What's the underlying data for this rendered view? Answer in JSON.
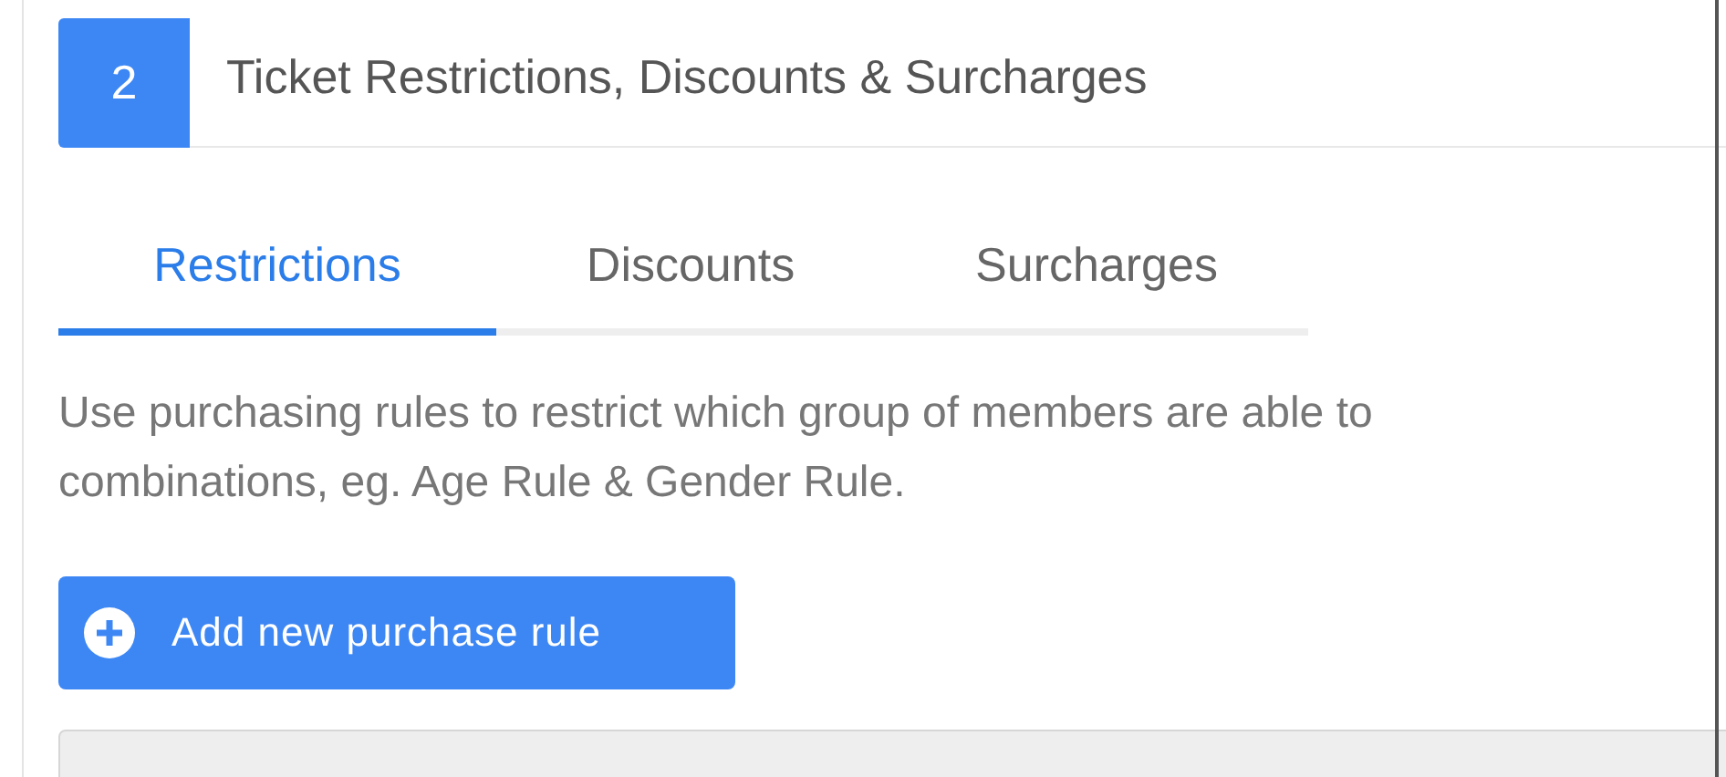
{
  "section": {
    "number": "2",
    "title": "Ticket Restrictions, Discounts & Surcharges"
  },
  "tabs": [
    {
      "label": "Restrictions",
      "selected": true
    },
    {
      "label": "Discounts",
      "selected": false
    },
    {
      "label": "Surcharges",
      "selected": false
    }
  ],
  "description": "Use purchasing rules to restrict which group of members are able to\ncombinations, eg. Age Rule & Gender Rule.",
  "add_button": {
    "label": "Add new purchase rule"
  }
}
